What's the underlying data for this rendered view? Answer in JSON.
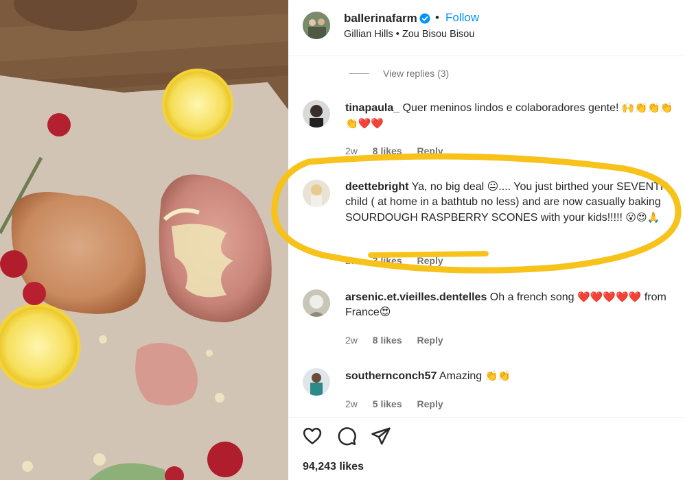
{
  "post": {
    "username": "ballerinafarm",
    "follow_label": "Follow",
    "dot": "•",
    "location": "Gillian Hills • Zou Bisou Bisou",
    "accent_color": "#0095f6",
    "verified_color": "#0095f6"
  },
  "view_replies": "View replies (3)",
  "comments": [
    {
      "username": "tinapaula_",
      "text": "Quer meninos lindos e colaboradores gente!",
      "emojis": "🙌👏👏👏👏❤️❤️",
      "time": "2w",
      "likes": "8 likes",
      "reply": "Reply"
    },
    {
      "username": "deettebright",
      "text": "Ya, no big deal 😐.... You just birthed your SEVENTH child ( at home in a bathtub no less) and are now casually baking SOURDOUGH RASPBERRY SCONES with your kids!!!!!",
      "emojis": "😮😍🙏",
      "time": "2w",
      "likes": "3 likes",
      "reply": "Reply"
    },
    {
      "username": "arsenic.et.vieilles.dentelles",
      "text": "Oh a french song",
      "emojis": "❤️❤️❤️❤️❤️",
      "text2": "from France😍",
      "time": "2w",
      "likes": "8 likes",
      "reply": "Reply"
    },
    {
      "username": "southernconch57",
      "text": "Amazing",
      "emojis": "👏👏",
      "time": "2w",
      "likes": "5 likes",
      "reply": "Reply"
    }
  ],
  "actions": {
    "like_icon": "heart-icon",
    "comment_icon": "comment-icon",
    "share_icon": "share-icon"
  },
  "likes_count": "94,243 likes",
  "highlight_color": "#f7c21a"
}
